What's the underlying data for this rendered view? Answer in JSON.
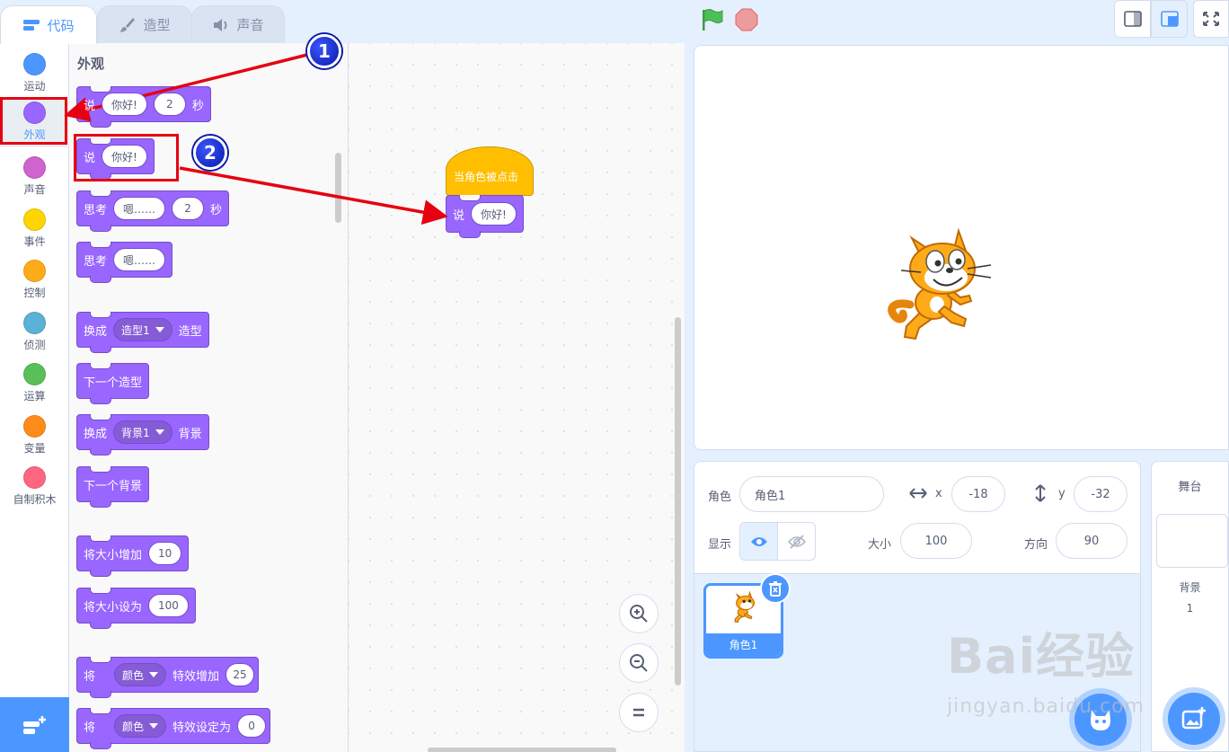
{
  "tabs": [
    {
      "label": "代码",
      "icon": "code-icon",
      "active": true
    },
    {
      "label": "造型",
      "icon": "brush-icon",
      "active": false
    },
    {
      "label": "声音",
      "icon": "speaker-icon",
      "active": false
    }
  ],
  "categories": [
    {
      "label": "运动",
      "color": "#4c97ff"
    },
    {
      "label": "外观",
      "color": "#9966ff",
      "selected": true
    },
    {
      "label": "声音",
      "color": "#cf63cf"
    },
    {
      "label": "事件",
      "color": "#ffd500"
    },
    {
      "label": "控制",
      "color": "#ffab19"
    },
    {
      "label": "侦测",
      "color": "#5cb1d6"
    },
    {
      "label": "运算",
      "color": "#59c059"
    },
    {
      "label": "变量",
      "color": "#ff8c1a"
    },
    {
      "label": "自制积木",
      "color": "#ff6680"
    }
  ],
  "palette": {
    "heading": "外观",
    "blocks": {
      "say_for": {
        "label": "说",
        "text": "你好!",
        "secs": "2",
        "unit": "秒"
      },
      "say": {
        "label": "说",
        "text": "你好!"
      },
      "think_for": {
        "label": "思考",
        "text": "嗯……",
        "secs": "2",
        "unit": "秒"
      },
      "think": {
        "label": "思考",
        "text": "嗯……"
      },
      "switch_costume": {
        "label": "换成",
        "value": "造型1",
        "suffix": "造型"
      },
      "next_costume": {
        "label": "下一个造型"
      },
      "switch_backdrop": {
        "label": "换成",
        "value": "背景1",
        "suffix": "背景"
      },
      "next_backdrop": {
        "label": "下一个背景"
      },
      "change_size": {
        "label": "将大小增加",
        "value": "10"
      },
      "set_size": {
        "label": "将大小设为",
        "value": "100"
      },
      "change_effect": {
        "label": "将",
        "effect": "颜色",
        "suffix": "特效增加",
        "value": "25"
      },
      "set_effect": {
        "label": "将",
        "effect": "颜色",
        "suffix": "特效设定为",
        "value": "0"
      }
    }
  },
  "script": {
    "hat_label": "当角色被点击",
    "say_label": "说",
    "say_text": "你好!"
  },
  "sprite_info": {
    "sprite_label": "角色",
    "sprite_name": "角色1",
    "x_label": "x",
    "x_value": "-18",
    "y_label": "y",
    "y_value": "-32",
    "show_label": "显示",
    "size_label": "大小",
    "size_value": "100",
    "direction_label": "方向",
    "direction_value": "90"
  },
  "sprites": [
    {
      "name": "角色1"
    }
  ],
  "stage_panel": {
    "title": "舞台",
    "backdrop_label": "背景",
    "backdrop_count": "1"
  },
  "annotations": {
    "badge1": "1",
    "badge2": "2"
  },
  "watermark": {
    "logo": "Bai经验",
    "url": "jingyan.baidu.com"
  },
  "colors": {
    "accent": "#4c97ff",
    "looks": "#9966ff",
    "events": "#ffbf00",
    "highlight": "#e60012"
  }
}
